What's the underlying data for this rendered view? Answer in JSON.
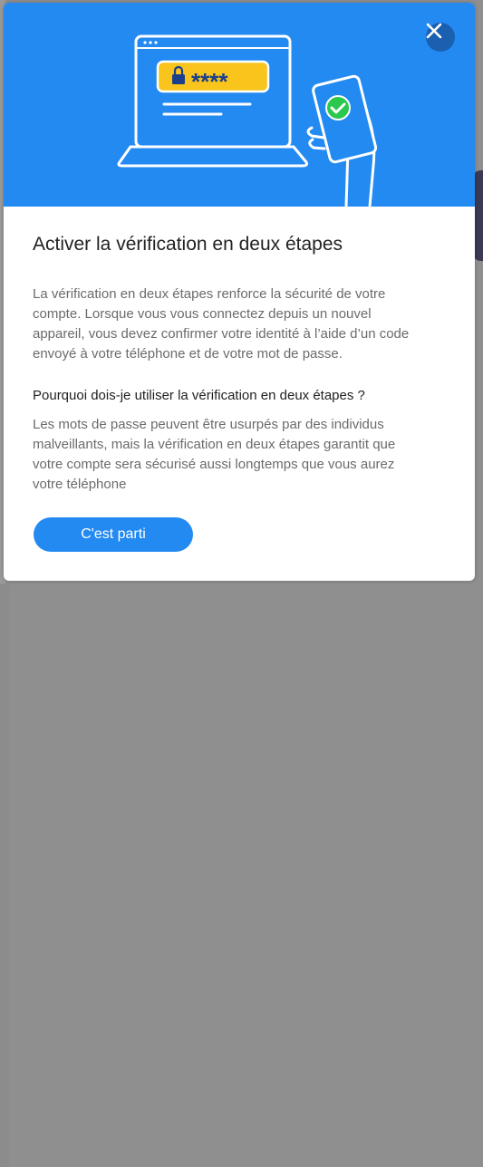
{
  "dialog": {
    "title": "Activer la vérification en deux étapes",
    "description": "La vérification en deux étapes renforce la sécurité de votre compte. Lorsque vous vous connectez depuis un nouvel appareil, vous devez confirmer votre identité à l’aide d’un code envoyé à votre téléphone et de votre mot de passe.",
    "question": "Pourquoi dois-je utiliser la vérification en deux étapes ?",
    "answer": "Les mots de passe peuvent être usurpés par des individus malveillants, mais la vérification en deux étapes garantit que votre compte sera sécurisé aussi longtemps que vous aurez votre téléphone",
    "cta_label": "C'est parti",
    "close_icon": "close-icon",
    "password_mask": "****"
  },
  "colors": {
    "accent": "#238af2",
    "hero_background": "#238af2",
    "close_button": "#1b5fb0",
    "password_field": "#f9c41c",
    "check": "#2cc84d"
  }
}
